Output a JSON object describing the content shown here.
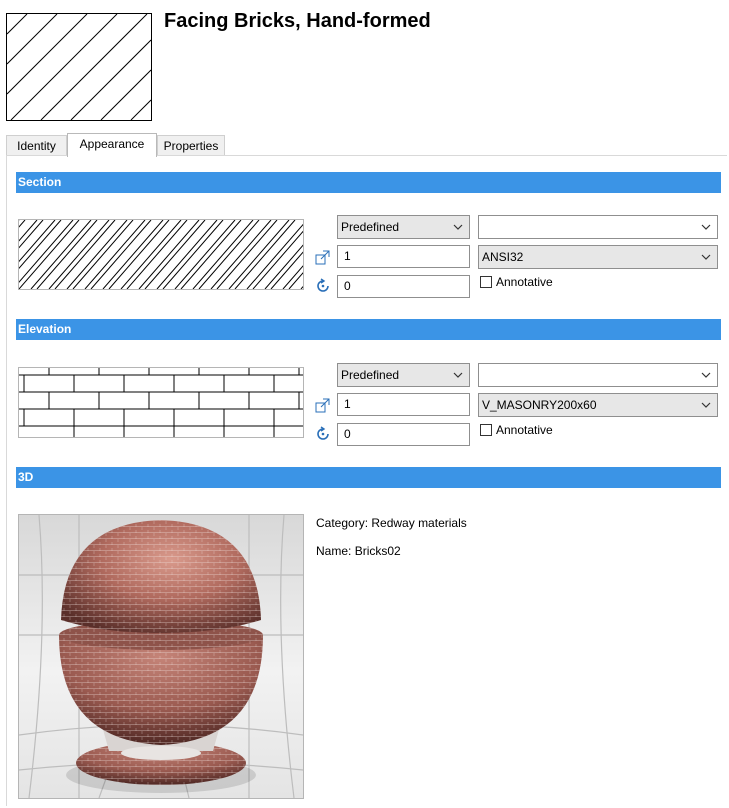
{
  "header": {
    "title": "Facing Bricks, Hand-formed"
  },
  "tabs": [
    {
      "label": "Identity",
      "active": false
    },
    {
      "label": "Appearance",
      "active": true
    },
    {
      "label": "Properties",
      "active": false
    }
  ],
  "section": {
    "heading": "Section",
    "pattern_type": "Predefined",
    "pattern_source": "",
    "scale": "1",
    "angle": "0",
    "pattern_name": "ANSI32",
    "annotative_label": "Annotative",
    "annotative_checked": false
  },
  "elevation": {
    "heading": "Elevation",
    "pattern_type": "Predefined",
    "pattern_source": "",
    "scale": "1",
    "angle": "0",
    "pattern_name": "V_MASONRY200x60",
    "annotative_label": "Annotative",
    "annotative_checked": false
  },
  "material3d": {
    "heading": "3D",
    "category_label": "Category:",
    "category_value": "Redway materials",
    "name_label": "Name:",
    "name_value": "Bricks02"
  },
  "icons": [
    "hatch-thumbnail-icon",
    "scale-icon",
    "rotate-icon",
    "chevron-down-icon",
    "checkbox-icon"
  ],
  "colors": {
    "section_bar": "#3b94e6",
    "brick": "#a9655a"
  }
}
